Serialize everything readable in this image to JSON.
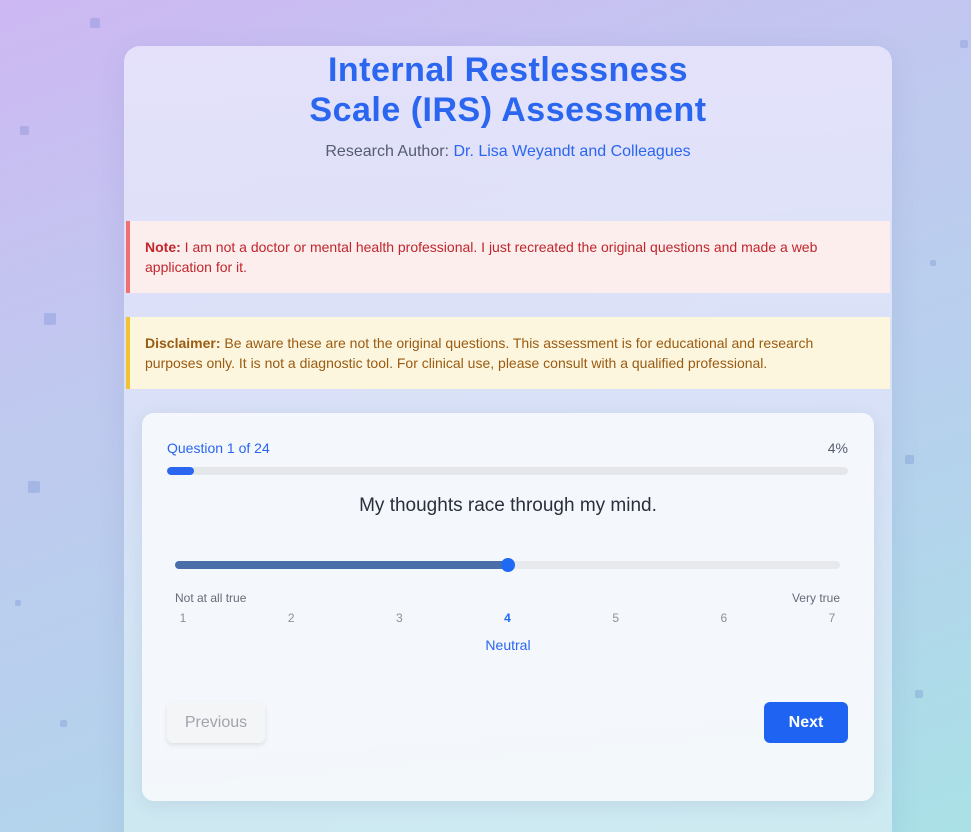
{
  "header": {
    "title_line1": "Internal Restlessness",
    "title_line2": "Scale (IRS) Assessment",
    "author_label": "Research Author:",
    "author_name": "Dr. Lisa Weyandt and Colleagues"
  },
  "note": {
    "label": "Note:",
    "text": "I am not a doctor or mental health professional. I just recreated the original questions and made a web application for it."
  },
  "disclaimer": {
    "label": "Disclaimer:",
    "text": "Be aware these are not the original questions. This assessment is for educational and research purposes only. It is not a diagnostic tool. For clinical use, please consult with a qualified professional."
  },
  "quiz": {
    "progress_label": "Question 1 of 24",
    "progress_percent_label": "4%",
    "progress_fraction": 0.04,
    "question": "My thoughts race through my mind.",
    "scale_low_label": "Not at all true",
    "scale_high_label": "Very true",
    "scale_values": [
      "1",
      "2",
      "3",
      "4",
      "5",
      "6",
      "7"
    ],
    "selected_value": 4,
    "selected_label": "Neutral",
    "previous_label": "Previous",
    "next_label": "Next"
  },
  "colors": {
    "accent": "#2a66ef",
    "note_border": "#f07070",
    "disclaimer_border": "#f2c230"
  }
}
